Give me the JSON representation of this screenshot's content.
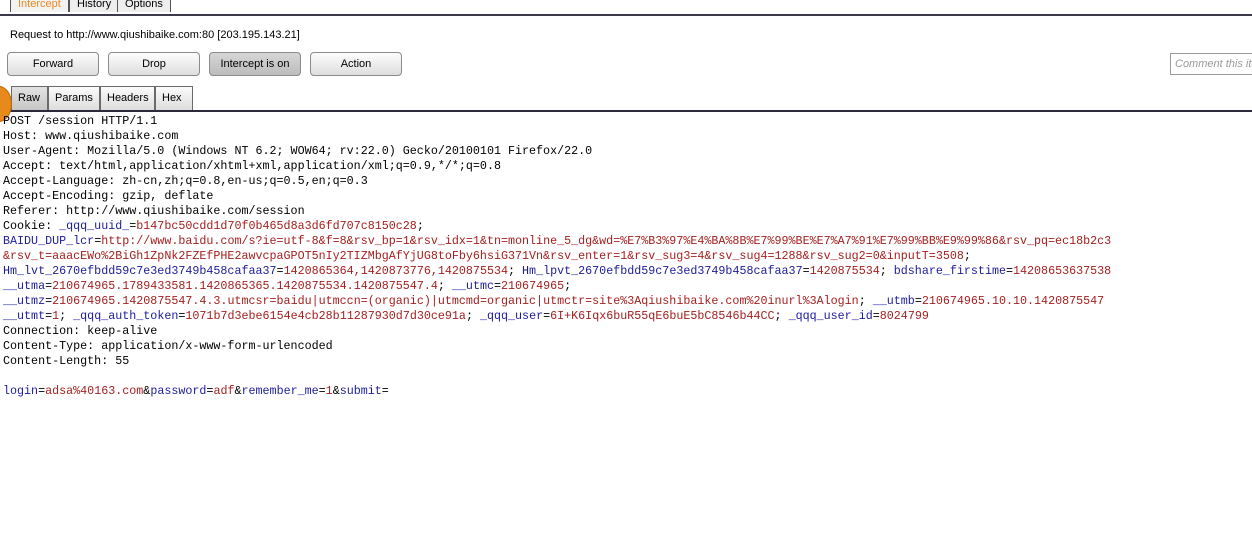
{
  "top_tabs": [
    "Intercept",
    "History",
    "Options"
  ],
  "request_label": "Request to http://www.qiushibaike.com:80  [203.195.143.21]",
  "buttons": {
    "forward": "Forward",
    "drop": "Drop",
    "intercept": "Intercept is on",
    "action": "Action"
  },
  "comment_placeholder": "Comment this item",
  "sub_tabs": [
    "Raw",
    "Params",
    "Headers",
    "Hex"
  ],
  "colors": {
    "accent": "#e58a1f",
    "param_name": "#1c1c9c",
    "param_value": "#a62020"
  },
  "request": {
    "lines": [
      "POST /session HTTP/1.1",
      "Host: www.qiushibaike.com",
      "User-Agent: Mozilla/5.0 (Windows NT 6.2; WOW64; rv:22.0) Gecko/20100101 Firefox/22.0",
      "Accept: text/html,application/xhtml+xml,application/xml;q=0.9,*/*;q=0.8",
      "Accept-Language: zh-cn,zh;q=0.8,en-us;q=0.5,en;q=0.3",
      "Accept-Encoding: gzip, deflate",
      "Referer: http://www.qiushibaike.com/session"
    ],
    "cookie_label": "Cookie: ",
    "cookie_segments": [
      [
        [
          "_qqq_uuid_",
          "k"
        ],
        [
          "=",
          "p"
        ],
        [
          "b147bc50cdd1d70f0b465d8a3d6fd707c8150c28",
          "v"
        ],
        [
          ";",
          "p"
        ]
      ],
      [
        [
          "BAIDU_DUP_lcr",
          "k"
        ],
        [
          "=",
          "p"
        ],
        [
          "http://www.baidu.com/s?ie=utf-8&f=8&rsv_bp=1&rsv_idx=1&tn=monline_5_dg&wd=%E7%B3%97%E4%BA%8B%E7%99%BE%E7%A7%91%E7%99%BB%E9%99%86&rsv_pq=ec18b2c3",
          "v"
        ]
      ],
      [
        [
          "&rsv_t=aaacEWo%2BiGh1ZpNk2FZEfPHE2awvcpaGPOT5nIy2TIZMbgAfYjUG8toFby6hsiG371Vn&rsv_enter=1&rsv_sug3=4&rsv_sug4=1288&rsv_sug2=0&inputT=3508",
          "v"
        ],
        [
          ";",
          "p"
        ]
      ],
      [
        [
          "Hm_lvt_2670efbdd59c7e3ed3749b458cafaa37",
          "k"
        ],
        [
          "=",
          "p"
        ],
        [
          "1420865364,1420873776,1420875534",
          "v"
        ],
        [
          "; ",
          "p"
        ],
        [
          "Hm_lpvt_2670efbdd59c7e3ed3749b458cafaa37",
          "k"
        ],
        [
          "=",
          "p"
        ],
        [
          "1420875534",
          "v"
        ],
        [
          "; ",
          "p"
        ],
        [
          "bdshare_firstime",
          "k"
        ],
        [
          "=",
          "p"
        ],
        [
          "14208653637538",
          "v"
        ]
      ],
      [
        [
          "__utma",
          "k"
        ],
        [
          "=",
          "p"
        ],
        [
          "210674965.1789433581.1420865365.1420875534.1420875547.4",
          "v"
        ],
        [
          "; ",
          "p"
        ],
        [
          "__utmc",
          "k"
        ],
        [
          "=",
          "p"
        ],
        [
          "210674965",
          "v"
        ],
        [
          ";",
          "p"
        ]
      ],
      [
        [
          "__utmz",
          "k"
        ],
        [
          "=",
          "p"
        ],
        [
          "210674965.1420875547.4.3.utmcsr=baidu|utmccn=(organic)|utmcmd=organic|utmctr=site%3Aqiushibaike.com%20inurl%3Alogin",
          "v"
        ],
        [
          "; ",
          "p"
        ],
        [
          "__utmb",
          "k"
        ],
        [
          "=",
          "p"
        ],
        [
          "210674965.10.10.1420875547",
          "v"
        ]
      ],
      [
        [
          "__utmt",
          "k"
        ],
        [
          "=",
          "p"
        ],
        [
          "1",
          "v"
        ],
        [
          "; ",
          "p"
        ],
        [
          "_qqq_auth_token",
          "k"
        ],
        [
          "=",
          "p"
        ],
        [
          "1071b7d3ebe6154e4cb28b11287930d7d30ce91a",
          "v"
        ],
        [
          "; ",
          "p"
        ],
        [
          "_qqq_user",
          "k"
        ],
        [
          "=",
          "p"
        ],
        [
          "6I+K6Iqx6buR55qE6buE5bC8546b44CC",
          "v"
        ],
        [
          "; ",
          "p"
        ],
        [
          "_qqq_user_id",
          "k"
        ],
        [
          "=",
          "p"
        ],
        [
          "8024799",
          "v"
        ]
      ]
    ],
    "after_lines": [
      "Connection: keep-alive",
      "Content-Type: application/x-www-form-urlencoded",
      "Content-Length: 55",
      ""
    ],
    "body_segments": [
      [
        "login",
        "k"
      ],
      [
        "=",
        "p"
      ],
      [
        "adsa%40163.com",
        "v"
      ],
      [
        "&",
        "p"
      ],
      [
        "password",
        "k"
      ],
      [
        "=",
        "p"
      ],
      [
        "adf",
        "v"
      ],
      [
        "&",
        "p"
      ],
      [
        "remember_me",
        "k"
      ],
      [
        "=",
        "p"
      ],
      [
        "1",
        "v"
      ],
      [
        "&",
        "p"
      ],
      [
        "submit",
        "k"
      ],
      [
        "=",
        "p"
      ]
    ]
  }
}
